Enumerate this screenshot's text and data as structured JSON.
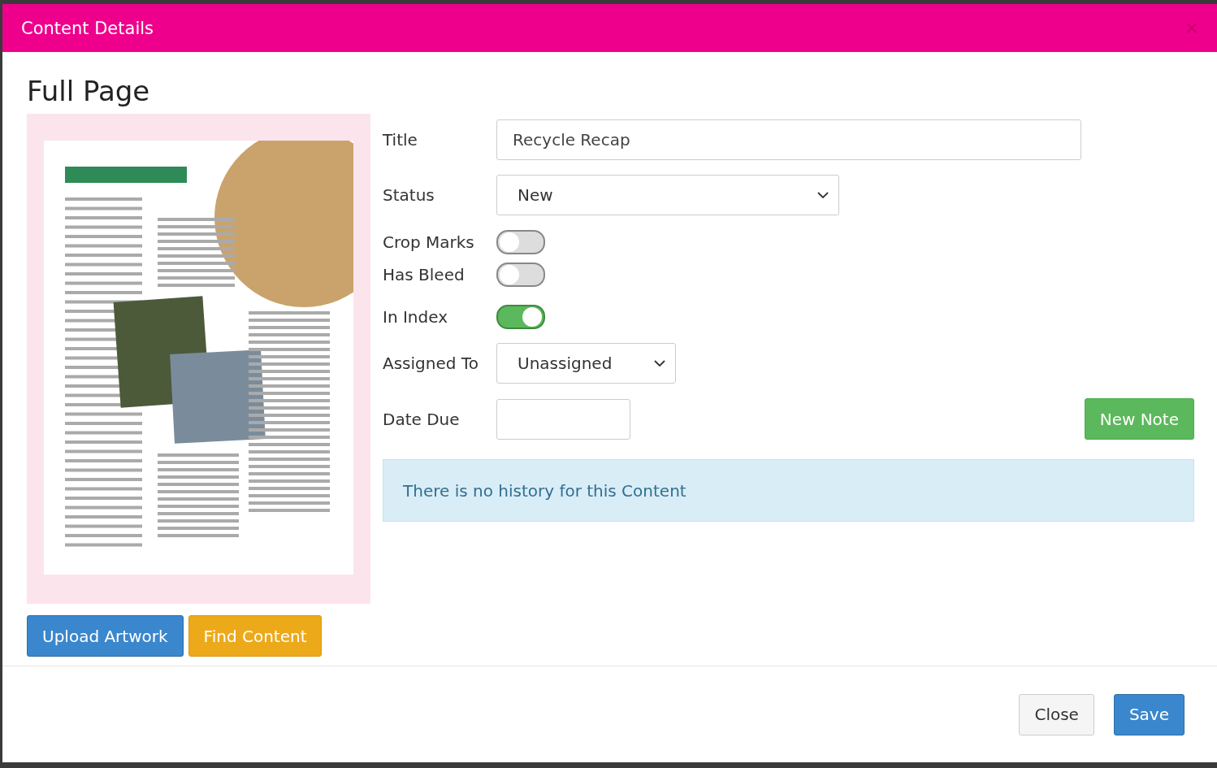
{
  "modal": {
    "title": "Content Details",
    "close": "×"
  },
  "page_type": "Full Page",
  "fields": [
    {
      "kind": "text",
      "label": "Title",
      "value": "Recycle Recap"
    },
    {
      "kind": "select",
      "label": "Status",
      "value": "New"
    },
    {
      "kind": "toggle",
      "label": "Crop Marks",
      "on": false
    },
    {
      "kind": "toggle",
      "label": "Has Bleed",
      "on": false
    },
    {
      "kind": "toggle",
      "label": "In Index",
      "on": true
    },
    {
      "kind": "select",
      "label": "Assigned To",
      "value": "Unassigned"
    },
    {
      "kind": "date",
      "label": "Date Due"
    }
  ],
  "new_note_button": "New Note",
  "history_message": "There is no history for this Content",
  "artwork_buttons": [
    "Upload Artwork",
    "Find Content"
  ],
  "footer_buttons": [
    "Close",
    "Save"
  ]
}
